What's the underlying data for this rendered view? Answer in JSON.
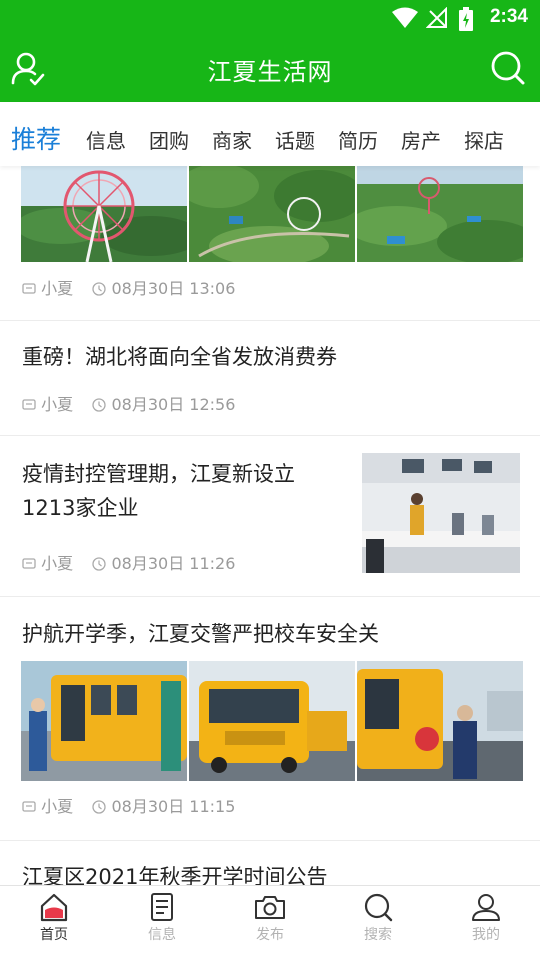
{
  "status_bar": {
    "time": "2:34"
  },
  "app_bar": {
    "title": "江夏生活网"
  },
  "tabs": [
    "推荐",
    "信息",
    "团购",
    "商家",
    "话题",
    "简历",
    "房产",
    "探店"
  ],
  "feed": [
    {
      "title": "",
      "author": "小夏",
      "time": "08月30日 13:06",
      "layout": "three-images"
    },
    {
      "title": "重磅！湖北将面向全省发放消费券",
      "author": "小夏",
      "time": "08月30日 12:56",
      "layout": "text"
    },
    {
      "title": "疫情封控管理期，江夏新设立1213家企业",
      "title_line1": "疫情封控管理期，江夏新设立",
      "title_line2": "1213家企业",
      "author": "小夏",
      "time": "08月30日 11:26",
      "layout": "right-image"
    },
    {
      "title": "护航开学季，江夏交警严把校车安全关",
      "author": "小夏",
      "time": "08月30日 11:15",
      "layout": "three-images"
    },
    {
      "title": "江夏区2021年秋季开学时间公告",
      "layout": "text"
    }
  ],
  "bottom_nav": [
    {
      "label": "首页",
      "icon": "home-icon",
      "active": true
    },
    {
      "label": "信息",
      "icon": "document-icon",
      "active": false
    },
    {
      "label": "发布",
      "icon": "camera-icon",
      "active": false
    },
    {
      "label": "搜索",
      "icon": "search-icon",
      "active": false
    },
    {
      "label": "我的",
      "icon": "user-icon",
      "active": false
    }
  ],
  "colors": {
    "brand_green": "#17b617",
    "active_tab_blue": "#1a7fd8",
    "home_red": "#e8394a"
  }
}
